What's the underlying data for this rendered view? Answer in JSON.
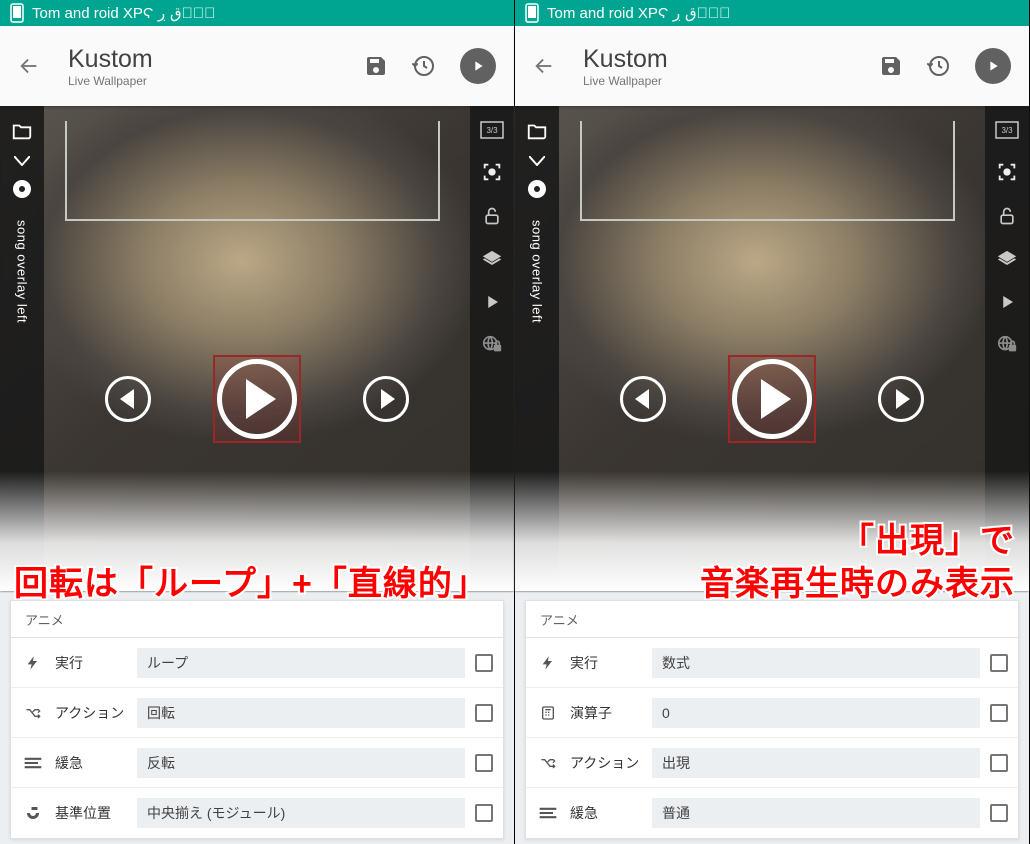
{
  "status_bar": {
    "title": "Tom and roid XPϚ ؞ۣۜق ڔ"
  },
  "toolbar": {
    "app_title": "Kustom",
    "app_sub": "Live Wallpaper"
  },
  "left_rail": {
    "vlabel": "song overlay left"
  },
  "right_rail": {
    "aspect_badge": "3/3"
  },
  "annotations": {
    "left": "回転は「ループ」+「直線的」",
    "right_line1": "「出現」で",
    "right_line2": "音楽再生時のみ表示"
  },
  "panel": {
    "tab": "アニメ"
  },
  "left_rows": [
    {
      "icon": "bolt",
      "label": "実行",
      "value": "ループ"
    },
    {
      "icon": "shuffle",
      "label": "アクション",
      "value": "回転"
    },
    {
      "icon": "lines",
      "label": "緩急",
      "value": "反転"
    },
    {
      "icon": "anchor",
      "label": "基準位置",
      "value": "中央揃え (モジュール)"
    }
  ],
  "right_rows": [
    {
      "icon": "bolt",
      "label": "実行",
      "value": "数式"
    },
    {
      "icon": "calc",
      "label": "演算子",
      "value": "0"
    },
    {
      "icon": "shuffle",
      "label": "アクション",
      "value": "出現"
    },
    {
      "icon": "lines",
      "label": "緩急",
      "value": "普通"
    }
  ]
}
